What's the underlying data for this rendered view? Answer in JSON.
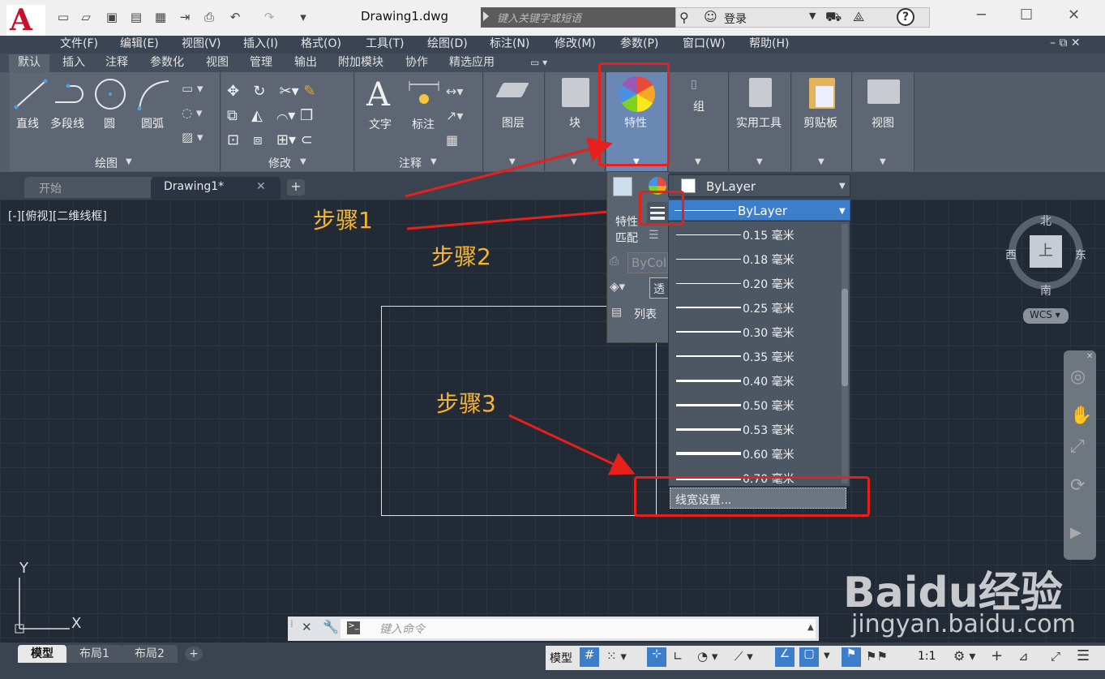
{
  "title_bar": {
    "doc_title": "Drawing1.dwg",
    "search_placeholder": "键入关键字或短语",
    "login": "登录"
  },
  "menu": [
    "文件(F)",
    "编辑(E)",
    "视图(V)",
    "插入(I)",
    "格式(O)",
    "工具(T)",
    "绘图(D)",
    "标注(N)",
    "修改(M)",
    "参数(P)",
    "窗口(W)",
    "帮助(H)"
  ],
  "ribbon_tabs": [
    "默认",
    "插入",
    "注释",
    "参数化",
    "视图",
    "管理",
    "输出",
    "附加模块",
    "协作",
    "精选应用"
  ],
  "draw_tools": [
    "直线",
    "多段线",
    "圆",
    "圆弧"
  ],
  "panel_titles": {
    "draw": "绘图",
    "modify": "修改",
    "annotate": "注释"
  },
  "annotate_tools": [
    "文字",
    "标注"
  ],
  "big_tools": [
    "图层",
    "块",
    "特性",
    "组",
    "实用工具",
    "剪贴板",
    "视图"
  ],
  "doc_tabs": {
    "start": "开始",
    "drawing": "Drawing1*"
  },
  "viewport_label": "[-][俯视][二维线框]",
  "steps": [
    "步骤1",
    "步骤2",
    "步骤3"
  ],
  "props_panel": {
    "match_label_1": "特性",
    "match_label_2": "匹配",
    "bycolor": "ByColo",
    "transparency": "透",
    "list_label": "列表",
    "color_value": "ByLayer",
    "lineweight_value": "ByLayer"
  },
  "lineweights": [
    {
      "label": "0.15 毫米",
      "mm": 0.15
    },
    {
      "label": "0.18 毫米",
      "mm": 0.18
    },
    {
      "label": "0.20 毫米",
      "mm": 0.2
    },
    {
      "label": "0.25 毫米",
      "mm": 0.25
    },
    {
      "label": "0.30 毫米",
      "mm": 0.3
    },
    {
      "label": "0.35 毫米",
      "mm": 0.35
    },
    {
      "label": "0.40 毫米",
      "mm": 0.4
    },
    {
      "label": "0.50 毫米",
      "mm": 0.5
    },
    {
      "label": "0.53 毫米",
      "mm": 0.53
    },
    {
      "label": "0.60 毫米",
      "mm": 0.6
    },
    {
      "label": "0.70 毫米",
      "mm": 0.7
    }
  ],
  "lineweight_settings": "线宽设置...",
  "viewcube": {
    "north": "北",
    "south": "南",
    "east": "东",
    "west": "西",
    "face": "上",
    "wcs": "WCS"
  },
  "command_placeholder": "键入命令",
  "layout_tabs": [
    "模型",
    "布局1",
    "布局2"
  ],
  "status": {
    "model": "模型",
    "scale": "1:1"
  },
  "ucs": {
    "x": "X",
    "y": "Y"
  },
  "watermark": {
    "brand": "Baidu经验",
    "url": "jingyan.baidu.com"
  },
  "colors": {
    "accent_red": "#e8201c",
    "step_orange": "#f5b531",
    "selected_blue": "#3d7ecb"
  }
}
